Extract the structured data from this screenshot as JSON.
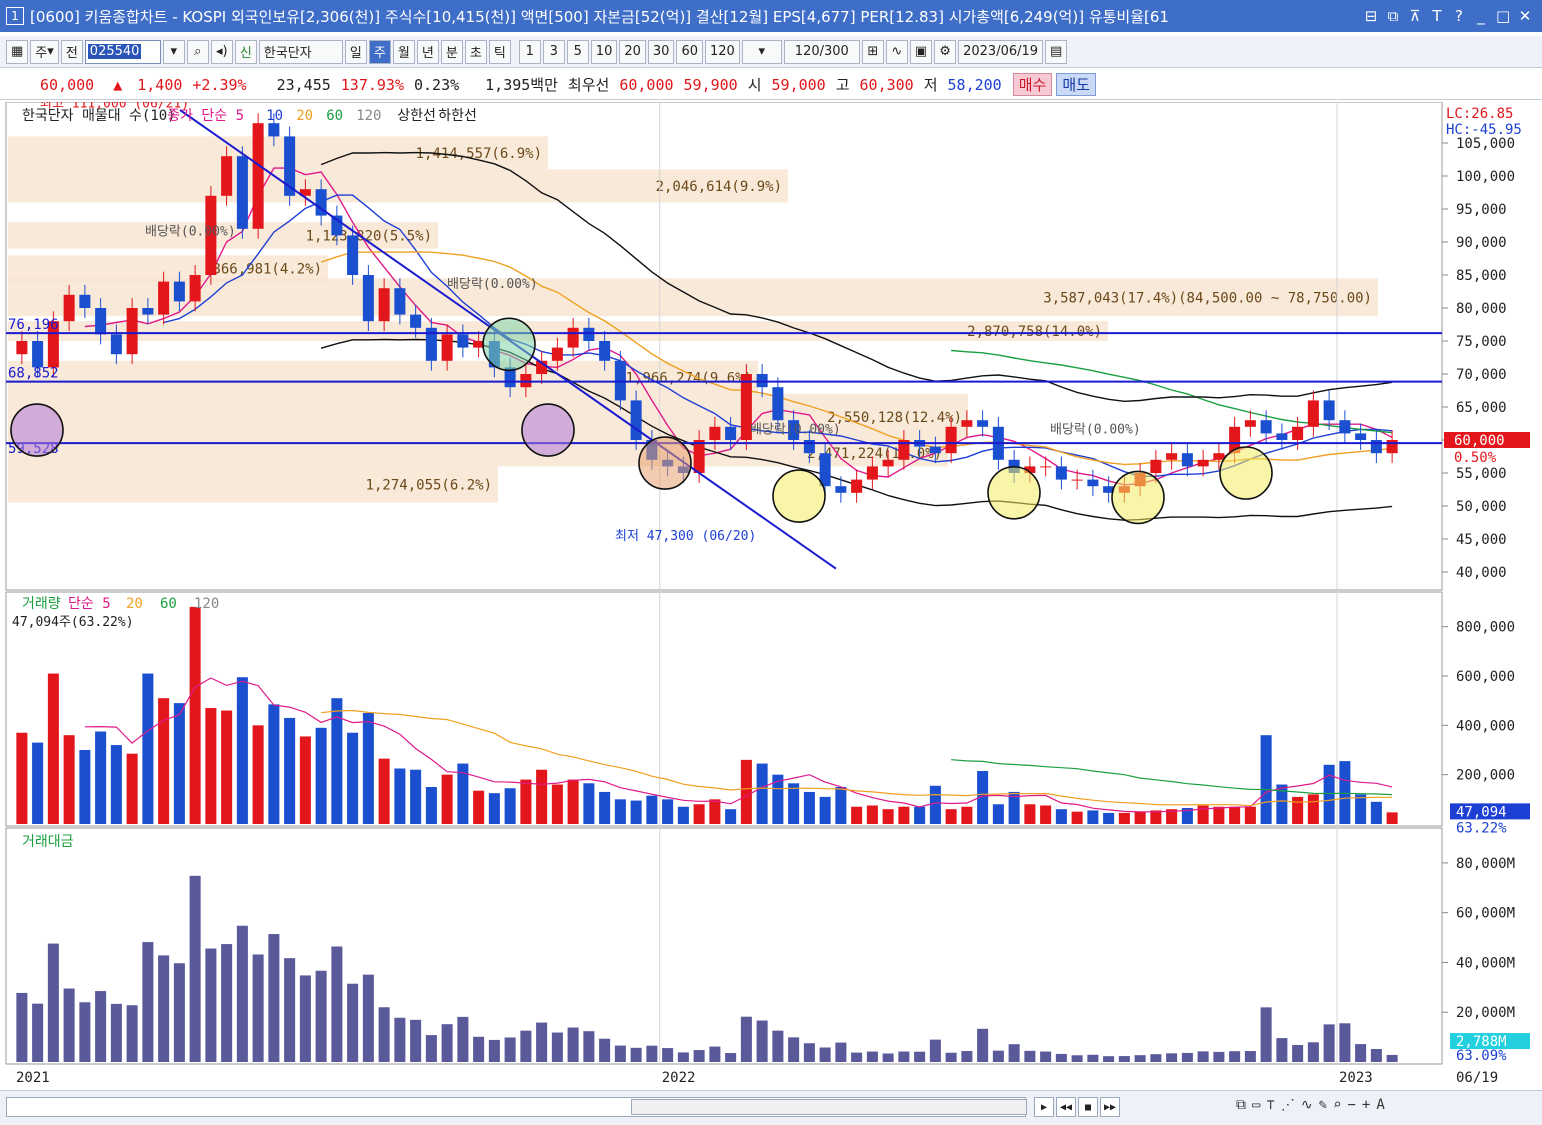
{
  "window": {
    "number": "1",
    "title": "[0600] 키움종합차트 - KOSPI 외국인보유[2,306(천)] 주식수[10,415(천)] 액면[500] 자본금[52(억)] 결산[12월] EPS[4,677] PER[12.83] 시가총액[6,249(억)] 유통비율[61",
    "controls": [
      "⊟",
      "⧉",
      "⊼",
      "T",
      "?",
      "_",
      "□",
      "✕"
    ]
  },
  "toolbar": {
    "type_label": "주",
    "prev_label": "전",
    "code": "025540",
    "credit": "신",
    "name": "한국단자",
    "periods": [
      "일",
      "주",
      "월",
      "년",
      "분",
      "초",
      "틱"
    ],
    "active_period": "주",
    "intervals": [
      "1",
      "3",
      "5",
      "10",
      "20",
      "30",
      "60",
      "120"
    ],
    "count": "120",
    "count_max": "/300",
    "date": "2023/06/19"
  },
  "info": {
    "price": "60,000",
    "arrow": "▲",
    "change": "1,400",
    "pct": "+2.39%",
    "volume": "23,455",
    "vol_ratio": "137.93%",
    "turnover": "0.23%",
    "amount": "1,395백만",
    "pref_label": "최우선",
    "ask": "60,000",
    "bid": "59,900",
    "open_label": "시",
    "open": "59,000",
    "high_label": "고",
    "high": "60,300",
    "low_label": "저",
    "low": "58,200",
    "buy_label": "매수",
    "sell_label": "매도"
  },
  "price_panel": {
    "legend": [
      "한국단자 매물대 수(10)",
      "종가 단순 5",
      "10",
      "20",
      "60",
      "120",
      "상한선",
      "하한선"
    ],
    "lc": "LC:26.85",
    "hc": "HC:-45.95",
    "y_ticks": [
      "105,000",
      "100,000",
      "95,000",
      "90,000",
      "85,000",
      "80,000",
      "75,000",
      "70,000",
      "65,000",
      "60,000",
      "55,000",
      "50,000",
      "45,000",
      "40,000"
    ],
    "current_price": "60,000",
    "current_pct": "0.50%",
    "max_label": "최고 111,000 (06/21)",
    "min_label": "최저 47,300 (06/20)",
    "levels": [
      "76,196",
      "68,852",
      "59,528"
    ],
    "volume_profile": [
      "1,414,557(6.9%)",
      "2,046,614(9.9%)",
      "1,123,820(5.5%)",
      "866,981(4.2%)",
      "3,587,043(17.4%)(84,500.00 ~ 78,750.00)",
      "2,870,758(14.0%)",
      "1,966,274(9.6%)",
      "2,550,128(12.4%)",
      "2,471,224(12.0%)",
      "1,274,055(6.2%)"
    ],
    "dividend_labels": [
      "배당락(0.00%)",
      "배당락(0.00%)",
      "배당락(0.00%)",
      "배당락(0.00%)"
    ]
  },
  "volume_panel": {
    "legend": [
      "거래량",
      "단순 5",
      "20",
      "60",
      "120"
    ],
    "note": "47,094주(63.22%)",
    "y_ticks": [
      "800,000",
      "600,000",
      "400,000",
      "200,000"
    ],
    "current": "47,094",
    "current_pct": "63.22%"
  },
  "amount_panel": {
    "legend": [
      "거래대금"
    ],
    "y_ticks": [
      "80,000M",
      "60,000M",
      "40,000M",
      "20,000M"
    ],
    "current": "2,788M",
    "current_pct": "63.09%"
  },
  "x_axis": {
    "labels": [
      "2021",
      "2022",
      "2023"
    ],
    "right": "06/19"
  },
  "colors": {
    "up": "#e2161b",
    "down": "#1a4fd0",
    "titlebar": "#3e6ec8"
  },
  "chart_data": {
    "type": "candlestick",
    "interval": "weekly",
    "closes": [
      75000,
      71000,
      78000,
      82000,
      80000,
      76000,
      73000,
      80000,
      79000,
      84000,
      81000,
      85000,
      97000,
      103000,
      92000,
      108000,
      106000,
      97000,
      98000,
      94000,
      91000,
      85000,
      78000,
      83000,
      79000,
      77000,
      72000,
      76000,
      74000,
      75000,
      71000,
      68000,
      70000,
      72000,
      74000,
      77000,
      75000,
      72000,
      66000,
      60000,
      57000,
      56000,
      55000,
      60000,
      62000,
      60000,
      70000,
      68000,
      63000,
      60000,
      58000,
      53000,
      52000,
      54000,
      56000,
      57000,
      60000,
      59000,
      58000,
      62000,
      63000,
      62000,
      57000,
      55000,
      56000,
      56000,
      54000,
      54000,
      53000,
      52000,
      53000,
      55000,
      57000,
      58000,
      56000,
      57000,
      58000,
      62000,
      63000,
      61000,
      60000,
      62000,
      66000,
      63000,
      61000,
      60000,
      58000,
      60000
    ],
    "volumes": [
      370000,
      330000,
      610000,
      360000,
      300000,
      375000,
      320000,
      285000,
      610000,
      510000,
      490000,
      880000,
      470000,
      460000,
      595000,
      400000,
      485000,
      430000,
      355000,
      390000,
      510000,
      370000,
      450000,
      265000,
      225000,
      220000,
      150000,
      200000,
      245000,
      135000,
      125000,
      145000,
      180000,
      220000,
      160000,
      180000,
      165000,
      130000,
      100000,
      95000,
      115000,
      100000,
      70000,
      80000,
      100000,
      60000,
      260000,
      245000,
      200000,
      165000,
      130000,
      110000,
      150000,
      70000,
      75000,
      60000,
      70000,
      70000,
      155000,
      60000,
      70000,
      215000,
      80000,
      130000,
      80000,
      75000,
      60000,
      50000,
      55000,
      45000,
      45000,
      50000,
      55000,
      60000,
      65000,
      75000,
      70000,
      70000,
      70000,
      360000,
      160000,
      110000,
      120000,
      240000,
      255000,
      120000,
      90000,
      47094
    ],
    "ylim": [
      40000,
      110000
    ]
  }
}
